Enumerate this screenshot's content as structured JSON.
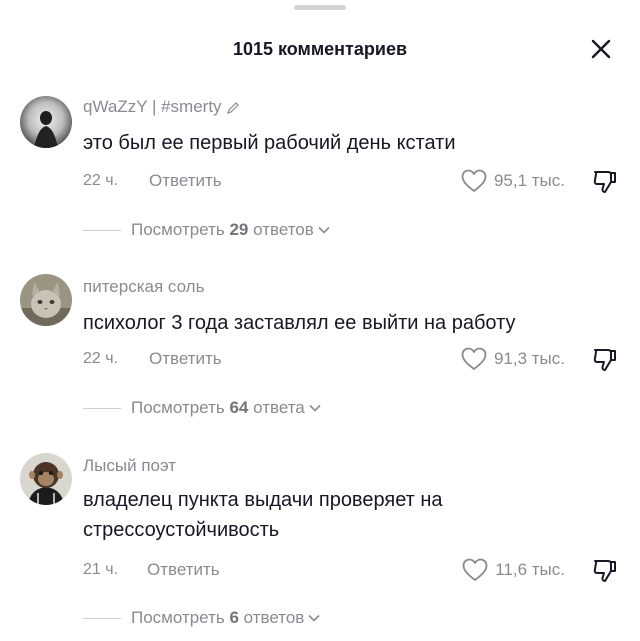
{
  "header": {
    "count": "1015",
    "title_suffix": "комментариев"
  },
  "comments": [
    {
      "username": "qWaZzY | #smerty",
      "text": "это был ее первый рабочий день кстати",
      "time": "22 ч.",
      "reply_label": "Ответить",
      "likes": "95,1 тыс.",
      "replies_prefix": "Посмотреть",
      "replies_count": "29",
      "replies_suffix": "ответов",
      "edited_icon": "pencil-icon"
    },
    {
      "username": "питерская соль",
      "text": "психолог 3 года заставлял ее выйти на работу",
      "time": "22 ч.",
      "reply_label": "Ответить",
      "likes": "91,3 тыс.",
      "replies_prefix": "Посмотреть",
      "replies_count": "64",
      "replies_suffix": "ответа"
    },
    {
      "username": "Лысый поэт",
      "text": "владелец пункта выдачи проверяет на стрессоустойчивость",
      "time": "21 ч.",
      "reply_label": "Ответить",
      "likes": "11,6 тыс.",
      "replies_prefix": "Посмотреть",
      "replies_count": "6",
      "replies_suffix": "ответов"
    }
  ],
  "colors": {
    "text_primary": "#161823",
    "text_secondary": "#8a8b91",
    "divider": "#d0d1d3",
    "background": "#ffffff"
  },
  "icons": [
    "close-icon",
    "heart-icon",
    "dislike-icon",
    "chevron-down-icon",
    "pencil-icon"
  ]
}
